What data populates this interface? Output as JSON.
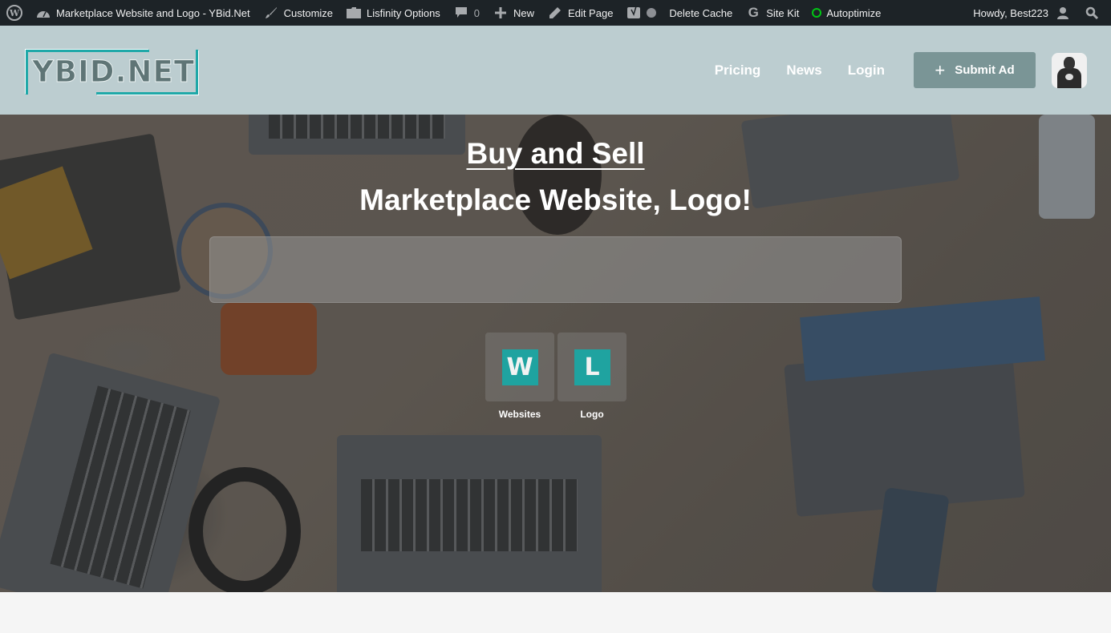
{
  "admin_bar": {
    "site_name": "Marketplace Website and Logo - YBid.Net",
    "customize": "Customize",
    "theme_options": "Lisfinity Options",
    "comments_count": "0",
    "new": "New",
    "edit_page": "Edit Page",
    "delete_cache": "Delete Cache",
    "site_kit": "Site Kit",
    "autoptimize": "Autoptimize",
    "greeting": "Howdy, Best223",
    "status_color": "#00c814"
  },
  "header": {
    "logo_text": "YBID.NET",
    "nav": [
      {
        "label": "Pricing"
      },
      {
        "label": "News"
      },
      {
        "label": "Login"
      }
    ],
    "submit_button": {
      "icon": "+",
      "label": "Submit Ad"
    },
    "brand_color": "#1fa8a8"
  },
  "hero": {
    "title": "Buy and Sell",
    "subtitle": "Marketplace Website, Logo!",
    "search_placeholder": "",
    "categories": [
      {
        "letter": "W",
        "label": "Websites"
      },
      {
        "letter": "L",
        "label": "Logo"
      }
    ]
  }
}
